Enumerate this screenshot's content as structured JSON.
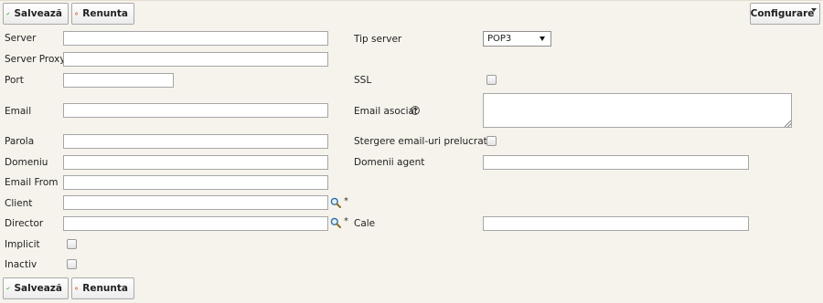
{
  "toolbar": {
    "save_label": "Salvează",
    "cancel_label": "Renunta",
    "config_label": "Configurare"
  },
  "form": {
    "server_label": "Server",
    "server_value": "",
    "server_proxy_label": "Server Proxy",
    "server_proxy_value": "",
    "port_label": "Port",
    "port_value": "",
    "email_label": "Email",
    "email_value": "",
    "parola_label": "Parola",
    "parola_value": "",
    "domeniu_label": "Domeniu",
    "domeniu_value": "",
    "email_from_label": "Email From",
    "email_from_value": "",
    "client_label": "Client",
    "client_value": "",
    "director_label": "Director",
    "director_value": "",
    "implicit_label": "Implicit",
    "inactiv_label": "Inactiv",
    "tip_server_label": "Tip server",
    "tip_server_value": "POP3",
    "ssl_label": "SSL",
    "email_asociat_label": "Email asociat",
    "email_asociat_value": "",
    "stergere_label": "Stergere email-uri prelucrate",
    "domenii_agent_label": "Domenii agent",
    "domenii_agent_value": "",
    "cale_label": "Cale",
    "cale_value": "",
    "required_marker": "*"
  },
  "icons": {
    "save": "checkmark-icon",
    "cancel": "no-entry-icon",
    "search": "magnifier-icon",
    "help": "question-circle-icon"
  },
  "colors": {
    "background": "#f6f3ec",
    "save_check": "#3aa52c",
    "cancel_icon": "#e8602c"
  }
}
